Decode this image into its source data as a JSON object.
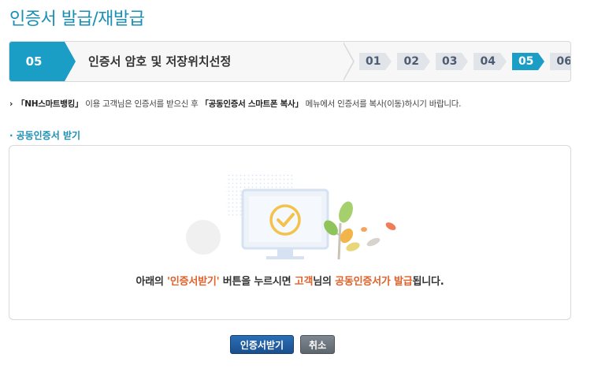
{
  "page": {
    "title": "인증서 발급/재발급"
  },
  "stepbar": {
    "current_number": "05",
    "current_title": "인증서 암호 및 저장위치선정",
    "steps": [
      {
        "label": "01",
        "active": false
      },
      {
        "label": "02",
        "active": false
      },
      {
        "label": "03",
        "active": false
      },
      {
        "label": "04",
        "active": false
      },
      {
        "label": "05",
        "active": true
      },
      {
        "label": "06",
        "active": false
      }
    ]
  },
  "notice": {
    "bracket1": "「NH스마트뱅킹」",
    "text1": " 이용 고객님은 인증서를 받으신 후 ",
    "bracket2": "「공동인증서 스마트폰 복사」",
    "text2": " 메뉴에서 인증서를 복사(이동)하시기 바랍니다."
  },
  "section": {
    "title": "공동인증서 받기"
  },
  "message": {
    "part1": "아래의 ",
    "hl1": "'인증서받기'",
    "part2": " 버튼을 누르시면 ",
    "hl2": "고객",
    "part3": "님의 ",
    "hl3": "공동인증서가 발급",
    "part4": "됩니다."
  },
  "buttons": {
    "receive": "인증서받기",
    "cancel": "취소"
  },
  "colors": {
    "accent": "#1b9ec6",
    "highlight": "#e0612a",
    "primary_button": "#1b4f8e"
  }
}
